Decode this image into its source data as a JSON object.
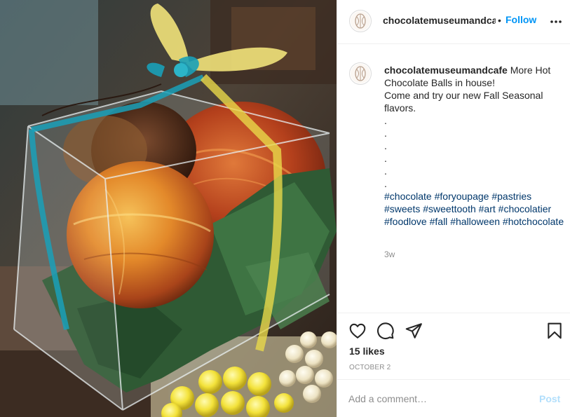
{
  "post": {
    "photo": {
      "icon": "photo-of-hot-chocolate-balls-in-clear-box"
    },
    "header": {
      "username": "chocolatemuseumandcafe",
      "separator": "•",
      "follow_label": "Follow",
      "avatar_icon": "cacao-pod-logo-icon",
      "more_icon": "more-options-icon"
    },
    "caption": {
      "username": "chocolatemuseumandcafe",
      "lines": [
        "More Hot Chocolate Balls in house!",
        "Come and try our new Fall Seasonal flavors.",
        ".",
        ".",
        ".",
        ".",
        ".",
        "."
      ],
      "hashtags": [
        "#chocolate",
        "#foryoupage",
        "#pastries",
        "#sweets",
        "#sweettooth",
        "#art",
        "#chocolatier",
        "#foodlove",
        "#fall",
        "#halloween",
        "#hotchocolate"
      ],
      "time": "3w"
    },
    "actions": {
      "like_icon": "heart-icon",
      "comment_icon": "comment-bubble-icon",
      "share_icon": "paper-plane-icon",
      "save_icon": "bookmark-icon",
      "likes": "15 likes",
      "date": "OCTOBER 2"
    },
    "comment_box": {
      "placeholder": "Add a comment…",
      "value": "",
      "post_label": "Post"
    },
    "colors": {
      "link_blue": "#0095f6",
      "hashtag_blue": "#00376b",
      "muted_text": "#8e8e8e",
      "disabled_post": "#b2dffc",
      "divider": "#efefef"
    }
  }
}
